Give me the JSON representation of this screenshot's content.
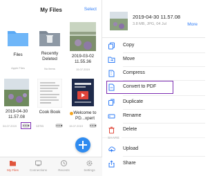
{
  "left_panel": {
    "title": "My Files",
    "select_label": "Select",
    "tiles": [
      {
        "name": "Files",
        "meta": "Apple Files"
      },
      {
        "name": "Recently Deleted",
        "meta": "No items"
      },
      {
        "name": "2019-03-02 11.55.36",
        "meta": "15.07.2019"
      },
      {
        "name": "2019-04-30 11.57.08",
        "meta": "04.07.2019"
      },
      {
        "name": "Cook Book",
        "meta": "12:51"
      },
      {
        "name": "Welcome to PD...xpert",
        "meta": "15.07.2019"
      }
    ],
    "tabs": [
      {
        "label": "My Files",
        "icon": "folder-icon",
        "active": true
      },
      {
        "label": "Connections",
        "icon": "connections-icon",
        "active": false
      },
      {
        "label": "Recents",
        "icon": "clock-icon",
        "active": false
      },
      {
        "label": "Settings",
        "icon": "gear-icon",
        "active": false
      }
    ]
  },
  "right_panel": {
    "file_title": "2019-04-30 11.57.08",
    "file_meta": "3.8 MB, JPG, 04 Jul",
    "more_label": "More",
    "actions": [
      {
        "label": "Copy",
        "icon": "copy-icon"
      },
      {
        "label": "Move",
        "icon": "move-icon"
      },
      {
        "label": "Compress",
        "icon": "compress-icon"
      },
      {
        "label": "Convert to PDF",
        "icon": "convert-pdf-icon",
        "highlighted": true
      },
      {
        "label": "Duplicate",
        "icon": "duplicate-icon"
      },
      {
        "label": "Rename",
        "icon": "rename-icon"
      },
      {
        "label": "Delete",
        "icon": "trash-icon"
      }
    ],
    "share_section": "SHARE",
    "share_actions": [
      {
        "label": "Upload",
        "icon": "upload-icon"
      },
      {
        "label": "Share",
        "icon": "share-icon"
      }
    ]
  },
  "colors": {
    "accent_blue": "#2e7bf6",
    "highlight_purple": "#7a2bb0",
    "delete_red": "#e04a3c",
    "active_tab": "#e0543b"
  }
}
